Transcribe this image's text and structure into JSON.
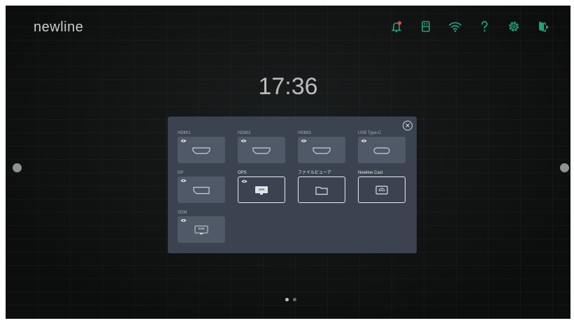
{
  "brand": "newline",
  "clock": "17:36",
  "status_bar": {
    "icons": [
      "bell-icon",
      "usb-drive-icon",
      "wifi-icon",
      "help-icon",
      "settings-gear-icon",
      "exit-icon"
    ],
    "accent_color": "#1aa67f",
    "alert_color": "#e04a4a"
  },
  "source_panel": {
    "close_symbol": "✕",
    "sources": [
      {
        "label": "HDMI1",
        "icon": "hdmi-port-icon",
        "active": false,
        "preview": true
      },
      {
        "label": "HDMI2",
        "icon": "hdmi-port-icon",
        "active": false,
        "preview": true
      },
      {
        "label": "HDMI3",
        "icon": "hdmi-port-icon",
        "active": false,
        "preview": true
      },
      {
        "label": "USB Type-C",
        "icon": "usb-c-port-icon",
        "active": false,
        "preview": true
      },
      {
        "label": "DP",
        "icon": "displayport-icon",
        "active": false,
        "preview": true
      },
      {
        "label": "OPS",
        "icon": "ops-monitor-icon",
        "active": true,
        "preview": true,
        "sub": "OPS"
      },
      {
        "label": "ファイルビューア",
        "icon": "folder-icon",
        "active": true,
        "preview": false
      },
      {
        "label": "Newline Cast",
        "icon": "cast-icon",
        "active": true,
        "preview": false
      },
      {
        "label": "SDM",
        "icon": "sdm-monitor-icon",
        "active": false,
        "preview": true,
        "sub": "SDM"
      }
    ]
  },
  "pager": {
    "pages": 2,
    "current": 1
  }
}
